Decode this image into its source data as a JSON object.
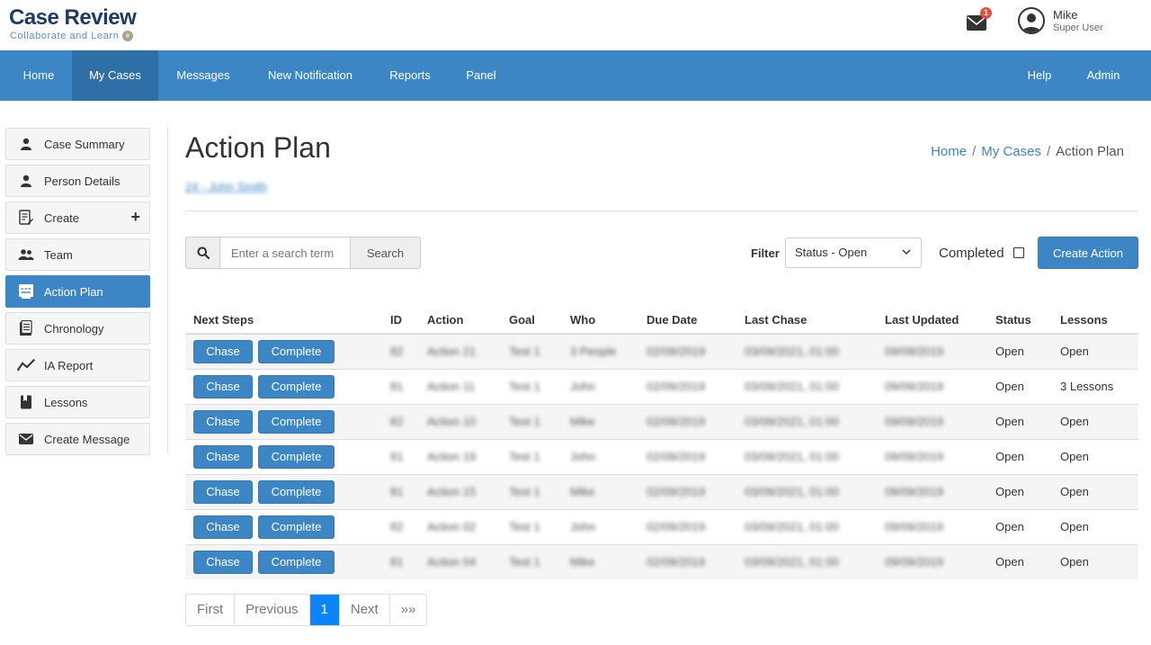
{
  "header": {
    "logo_title": "Case Review",
    "logo_subtitle": "Collaborate and Learn",
    "mail_badge": "1",
    "user_name": "Mike",
    "user_role": "Super User"
  },
  "nav": {
    "items": [
      "Home",
      "My Cases",
      "Messages",
      "New Notification",
      "Reports",
      "Panel"
    ],
    "active": "My Cases",
    "right_items": [
      "Help",
      "Admin"
    ]
  },
  "sidebar": {
    "items": [
      {
        "label": "Case Summary",
        "icon": "person-icon"
      },
      {
        "label": "Person Details",
        "icon": "person-icon"
      },
      {
        "label": "Create",
        "icon": "edit-document-icon"
      },
      {
        "label": "Team",
        "icon": "team-icon"
      },
      {
        "label": "Action Plan",
        "icon": "action-plan-icon"
      },
      {
        "label": "Chronology",
        "icon": "chronology-icon"
      },
      {
        "label": "IA Report",
        "icon": "line-chart-icon"
      },
      {
        "label": "Lessons",
        "icon": "bookmark-icon"
      },
      {
        "label": "Create Message",
        "icon": "envelope-icon"
      }
    ],
    "active": "Action Plan",
    "create_plus": "+"
  },
  "main": {
    "title": "Action Plan",
    "case_link": "24 - John Smith",
    "breadcrumb": [
      "Home",
      "My Cases",
      "Action Plan"
    ],
    "breadcrumb_sep": "/"
  },
  "toolbar": {
    "search_placeholder": "Enter a search term",
    "search_label": "Search",
    "filter_label": "Filter",
    "filter_value": "Status - Open",
    "completed_label": "Completed",
    "create_label": "Create Action"
  },
  "table": {
    "headers": [
      "Next Steps",
      "ID",
      "Action",
      "Goal",
      "Who",
      "Due Date",
      "Last Chase",
      "Last Updated",
      "Status",
      "Lessons"
    ],
    "chase_label": "Chase",
    "complete_label": "Complete",
    "rows": [
      {
        "id": "82",
        "action": "Action 21",
        "goal": "Test 1",
        "who": "3 People",
        "due": "02/09/2019",
        "last_chase": "03/09/2021, 01:00",
        "last_updated": "09/09/2019",
        "status": "Open",
        "lessons": "Open"
      },
      {
        "id": "81",
        "action": "Action 11",
        "goal": "Test 1",
        "who": "John",
        "due": "02/09/2019",
        "last_chase": "03/09/2021, 01:00",
        "last_updated": "09/09/2019",
        "status": "Open",
        "lessons": "3 Lessons"
      },
      {
        "id": "82",
        "action": "Action 10",
        "goal": "Test 1",
        "who": "Mike",
        "due": "02/09/2019",
        "last_chase": "03/09/2021, 01:00",
        "last_updated": "09/09/2019",
        "status": "Open",
        "lessons": "Open"
      },
      {
        "id": "81",
        "action": "Action 19",
        "goal": "Test 1",
        "who": "John",
        "due": "02/09/2019",
        "last_chase": "03/09/2021, 01:00",
        "last_updated": "09/09/2019",
        "status": "Open",
        "lessons": "Open"
      },
      {
        "id": "81",
        "action": "Action 15",
        "goal": "Test 1",
        "who": "Mike",
        "due": "02/09/2019",
        "last_chase": "03/09/2021, 01:00",
        "last_updated": "09/09/2019",
        "status": "Open",
        "lessons": "Open"
      },
      {
        "id": "82",
        "action": "Action 02",
        "goal": "Test 1",
        "who": "John",
        "due": "02/09/2019",
        "last_chase": "03/09/2021, 01:00",
        "last_updated": "09/09/2019",
        "status": "Open",
        "lessons": "Open"
      },
      {
        "id": "81",
        "action": "Action 04",
        "goal": "Test 1",
        "who": "Mike",
        "due": "02/09/2019",
        "last_chase": "03/09/2021, 01:00",
        "last_updated": "09/09/2019",
        "status": "Open",
        "lessons": "Open"
      }
    ]
  },
  "pagination": {
    "items": [
      "First",
      "Previous",
      "1",
      "Next",
      "»»"
    ],
    "active": "1"
  },
  "colors": {
    "primary": "#3d86c6",
    "nav_active": "#2f6fa7",
    "page_active": "#0d84ff",
    "badge": "#e74c3c"
  }
}
